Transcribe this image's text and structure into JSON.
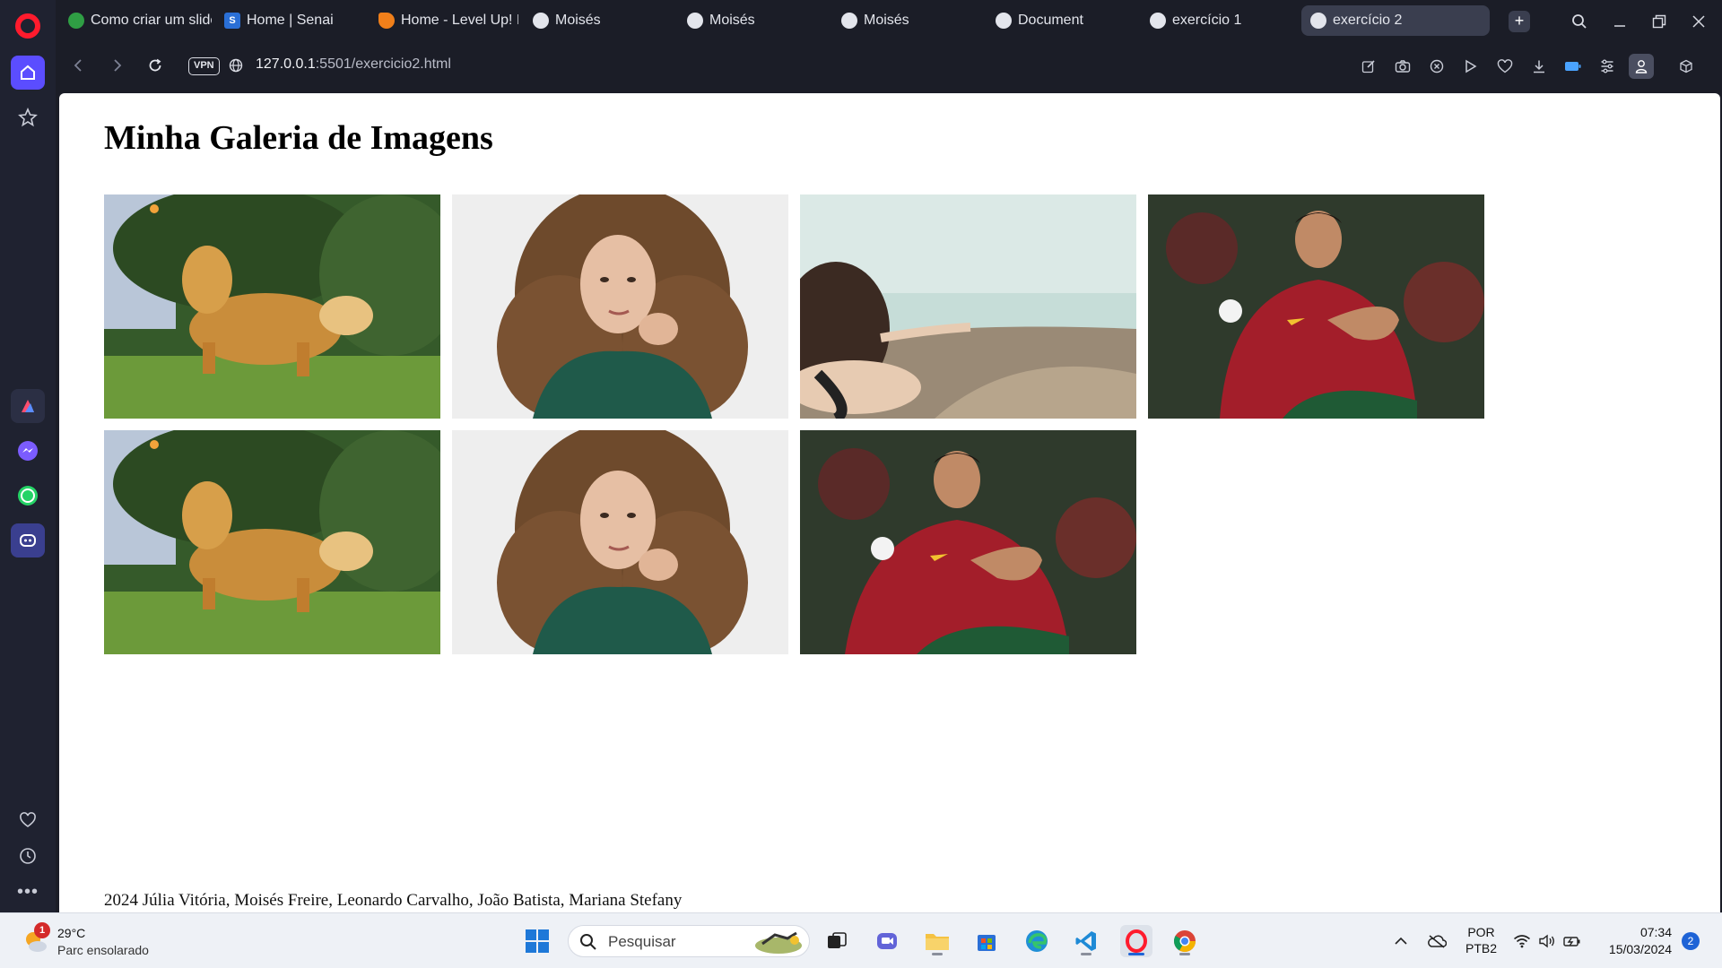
{
  "browser": {
    "tabs": [
      {
        "label": "Como criar um slider",
        "favicon": "green-circle-icon"
      },
      {
        "label": "Home | Senai",
        "favicon": "s-logo-icon"
      },
      {
        "label": "Home - Level Up! Br",
        "favicon": "orange-speech-icon"
      },
      {
        "label": "Moisés",
        "favicon": "globe-icon"
      },
      {
        "label": "Moisés",
        "favicon": "globe-icon"
      },
      {
        "label": "Moisés",
        "favicon": "globe-icon"
      },
      {
        "label": "Document",
        "favicon": "globe-icon"
      },
      {
        "label": "exercício 1",
        "favicon": "globe-icon"
      },
      {
        "label": "exercício 2",
        "favicon": "globe-icon",
        "active": true
      }
    ],
    "address": {
      "vpn_label": "VPN",
      "host": "127.0.0.1",
      "path": ":5501/exercicio2.html"
    }
  },
  "page": {
    "title": "Minha Galeria de Imagens",
    "images": [
      {
        "subject": "golden retriever dog on grass"
      },
      {
        "subject": "woman with curly hair in green sweater"
      },
      {
        "subject": "woman looking at fish in clear water"
      },
      {
        "subject": "football player in red and green jersey"
      },
      {
        "subject": "golden retriever dog on grass"
      },
      {
        "subject": "woman with curly hair in green sweater"
      },
      {
        "subject": "football player in red and green jersey"
      }
    ],
    "footer": "2024 Júlia Vitória, Moisés Freire, Leonardo Carvalho, João Batista, Mariana Stefany"
  },
  "taskbar": {
    "weather": {
      "temp": "29°C",
      "desc": "Parc ensolarado",
      "badge": "1"
    },
    "search_placeholder": "Pesquisar",
    "language": {
      "lang": "POR",
      "layout": "PTB2"
    },
    "clock": {
      "time": "07:34",
      "date": "15/03/2024"
    },
    "notifications": "2"
  },
  "colors": {
    "opera_red": "#ff1b2d",
    "accent": "#5b4dff",
    "browser_bg": "#1b1d27",
    "taskbar_bg": "#eef1f6"
  }
}
